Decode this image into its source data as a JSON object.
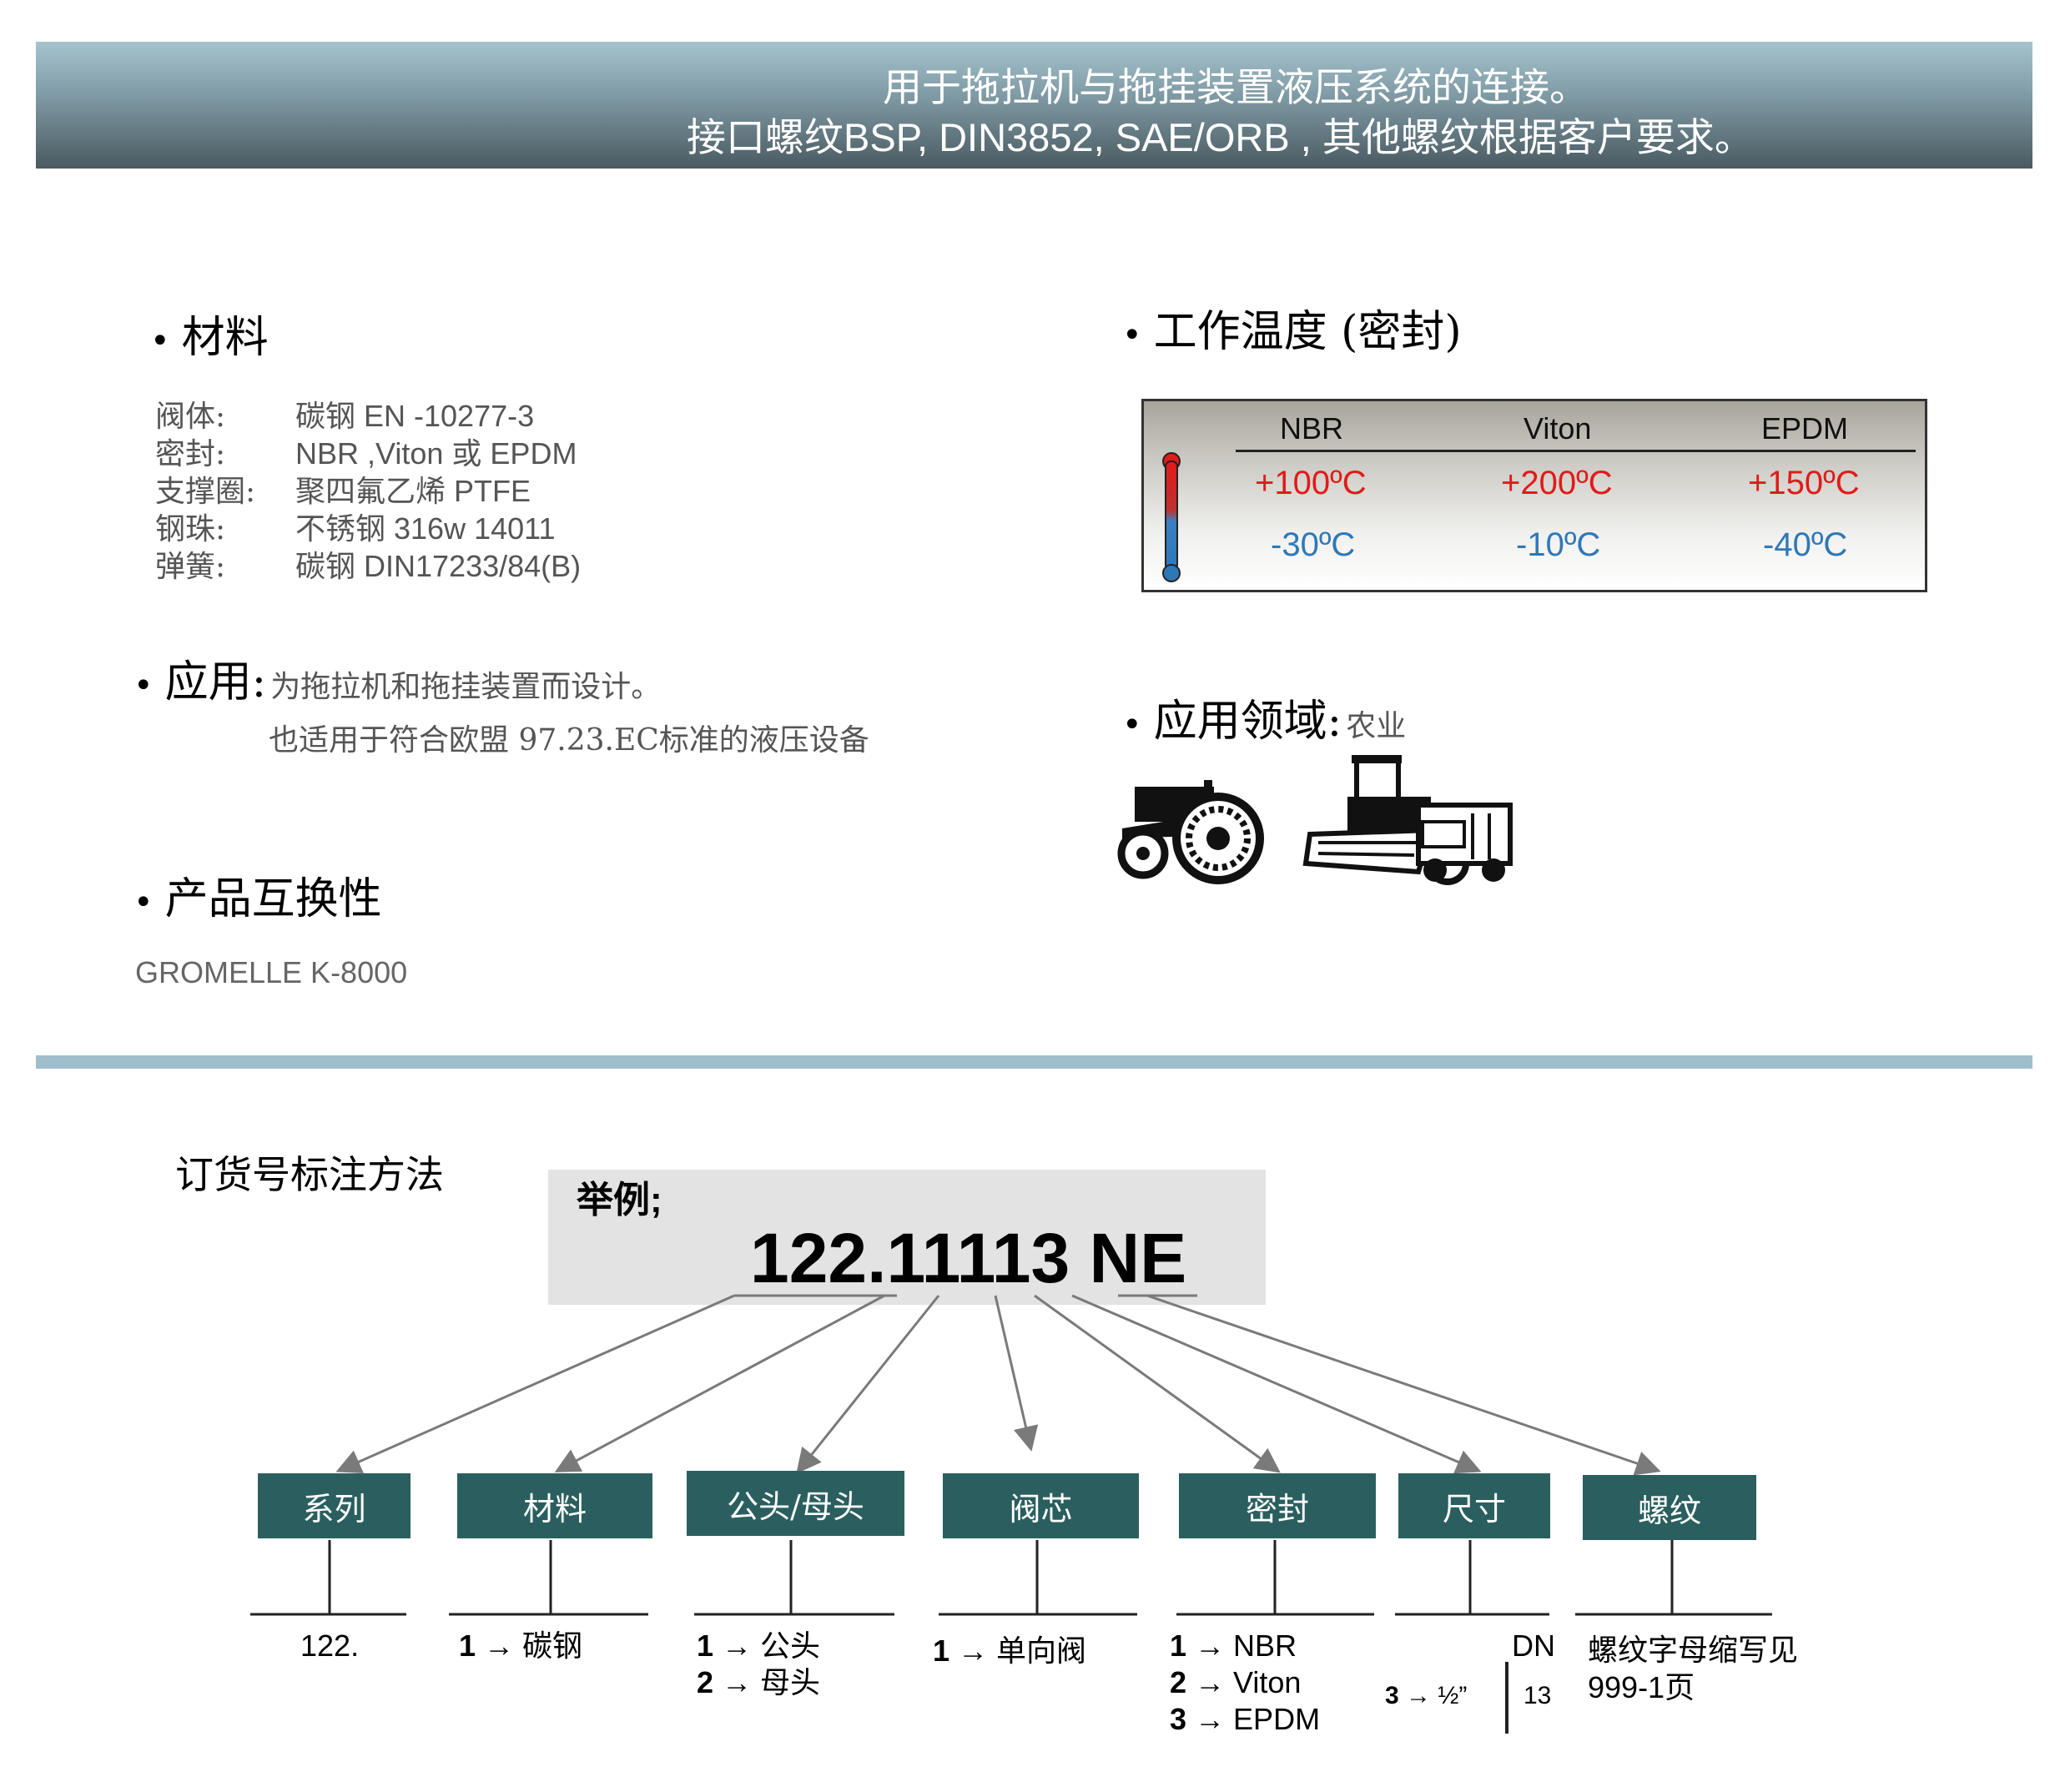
{
  "header": {
    "line1": "用于拖拉机与拖挂装置液压系统的连接。",
    "line2": "接口螺纹BSP, DIN3852, SAE/ORB , 其他螺纹根据客户要求。"
  },
  "materials": {
    "title": "材料",
    "rows": [
      {
        "label": "阀体:",
        "value": "碳钢 EN -10277-3"
      },
      {
        "label": "密封:",
        "value": "NBR ,Viton 或 EPDM"
      },
      {
        "label": "支撑圈:",
        "value": "聚四氟乙烯 PTFE"
      },
      {
        "label": "钢珠:",
        "value": "不锈钢 316w 14011"
      },
      {
        "label": "弹簧:",
        "value": "碳钢  DIN17233/84(B)"
      }
    ]
  },
  "application": {
    "title": "应用:",
    "line1": "为拖拉机和拖挂装置而设计。",
    "line2": "也适用于符合欧盟 97.23.EC标准的液压设备"
  },
  "interchange": {
    "title": "产品互换性",
    "value": "GROMELLE K-8000"
  },
  "temperature": {
    "title": "工作温度 (密封)",
    "columns": [
      {
        "name": "NBR",
        "max": "+100ºC",
        "min": "-30ºC"
      },
      {
        "name": "Viton",
        "max": "+200ºC",
        "min": "-10ºC"
      },
      {
        "name": "EPDM",
        "max": "+150ºC",
        "min": "-40ºC"
      }
    ],
    "hot_color": "#e21a1a",
    "cold_color": "#2f78b7"
  },
  "field": {
    "title": "应用领域:",
    "value": "农业"
  },
  "order": {
    "title": "订货号标注方法",
    "example_label": "举例;",
    "example_code": "122.11113 NE",
    "categories": [
      "系列",
      "材料",
      "公头/母头",
      "阀芯",
      "密封",
      "尺寸",
      "螺纹"
    ],
    "series_value": "122.",
    "material_value": {
      "num": "1",
      "text": "碳钢"
    },
    "gender_values": [
      {
        "num": "1",
        "text": "公头"
      },
      {
        "num": "2",
        "text": "母头"
      }
    ],
    "valve_value": {
      "num": "1",
      "text": "单向阀"
    },
    "seal_values": [
      {
        "num": "1",
        "text": "NBR"
      },
      {
        "num": "2",
        "text": "Viton"
      },
      {
        "num": "3",
        "text": "EPDM"
      }
    ],
    "size": {
      "dn_label": "DN",
      "code": "3",
      "inch": "½”",
      "dn": "13"
    },
    "thread_note_1": "螺纹字母缩写见",
    "thread_note_2": "999-1页"
  },
  "colors": {
    "accent": "#2b5f5f",
    "divider": "#9fbecb"
  }
}
